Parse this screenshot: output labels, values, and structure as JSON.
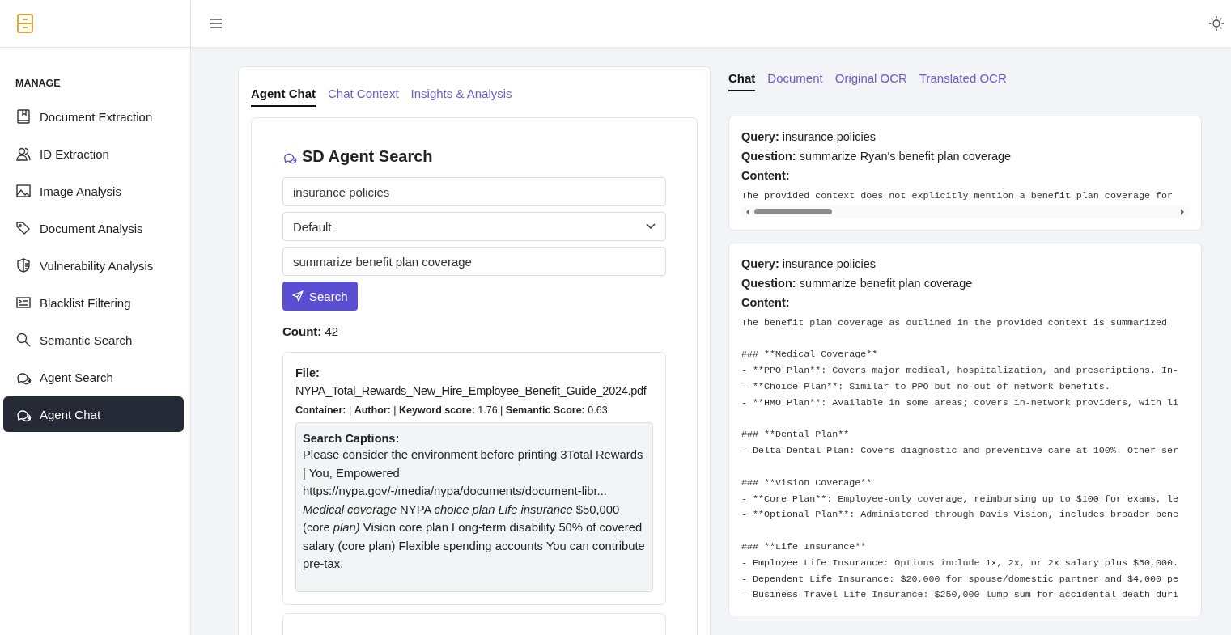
{
  "sidebar": {
    "section": "MANAGE",
    "items": [
      {
        "label": "Document Extraction",
        "selected": false
      },
      {
        "label": "ID Extraction",
        "selected": false
      },
      {
        "label": "Image Analysis",
        "selected": false
      },
      {
        "label": "Document Analysis",
        "selected": false
      },
      {
        "label": "Vulnerability Analysis",
        "selected": false
      },
      {
        "label": "Blacklist Filtering",
        "selected": false
      },
      {
        "label": "Semantic Search",
        "selected": false
      },
      {
        "label": "Agent Search",
        "selected": false
      },
      {
        "label": "Agent Chat",
        "selected": true
      }
    ]
  },
  "left_panel": {
    "tabs": [
      {
        "label": "Agent Chat",
        "selected": true
      },
      {
        "label": "Chat Context",
        "selected": false
      },
      {
        "label": "Insights & Analysis",
        "selected": false
      }
    ],
    "search": {
      "title": "SD Agent Search",
      "query": "insurance policies",
      "mode": "Default",
      "question": "summarize benefit plan coverage",
      "button": "Search"
    },
    "count": "**Count:** 42",
    "results": [
      {
        "file_label": "File:",
        "file": "NYPA_Total_Rewards_New_Hire_Employee_Benefit_Guide_2024.pdf",
        "meta": "**Container:** | **Author:** | **Keyword score:** 1.76 | **Semantic Score:** 0.63",
        "captions_label": "Search Captions:",
        "captions": "Please consider the environment before printing 3Total Rewards | You, Empowered https://nypa.gov/-/media/nypa/documents/document-libr... *Medical coverage* NYPA *choice plan Life insurance* $50,000 (core *plan)* Vision core plan Long-term disability 50% of covered salary (core plan) Flexible spending accounts You can contribute pre-tax."
      }
    ]
  },
  "right_panel": {
    "tabs": [
      {
        "label": "Chat",
        "selected": true
      },
      {
        "label": "Document",
        "selected": false
      },
      {
        "label": "Original OCR",
        "selected": false
      },
      {
        "label": "Translated OCR",
        "selected": false
      }
    ],
    "messages": [
      {
        "query": "**Query:** insurance policies",
        "question": "**Question:** summarize Ryan's benefit plan coverage",
        "content_label": "Content:",
        "content": "The provided context does not explicitly mention a benefit plan coverage for",
        "horizontal_scrollbar": true
      },
      {
        "query": "**Query:** insurance policies",
        "question": "**Question:** summarize benefit plan coverage",
        "content_label": "Content:",
        "content": "The benefit plan coverage as outlined in the provided context is summarized\n\n### **Medical Coverage**\n- **PPO Plan**: Covers major medical, hospitalization, and prescriptions. In-\n- **Choice Plan**: Similar to PPO but no out-of-network benefits.\n- **HMO Plan**: Available in some areas; covers in-network providers, with li\n\n### **Dental Plan**\n- Delta Dental Plan: Covers diagnostic and preventive care at 100%. Other ser\n\n### **Vision Coverage**\n- **Core Plan**: Employee-only coverage, reimbursing up to $100 for exams, le\n- **Optional Plan**: Administered through Davis Vision, includes broader bene\n\n### **Life Insurance**\n- Employee Life Insurance: Options include 1x, 2x, or 2x salary plus $50,000.\n- Dependent Life Insurance: $20,000 for spouse/domestic partner and $4,000 pe\n- Business Travel Life Insurance: $250,000 lump sum for accidental death duri",
        "horizontal_scrollbar": false
      }
    ]
  }
}
